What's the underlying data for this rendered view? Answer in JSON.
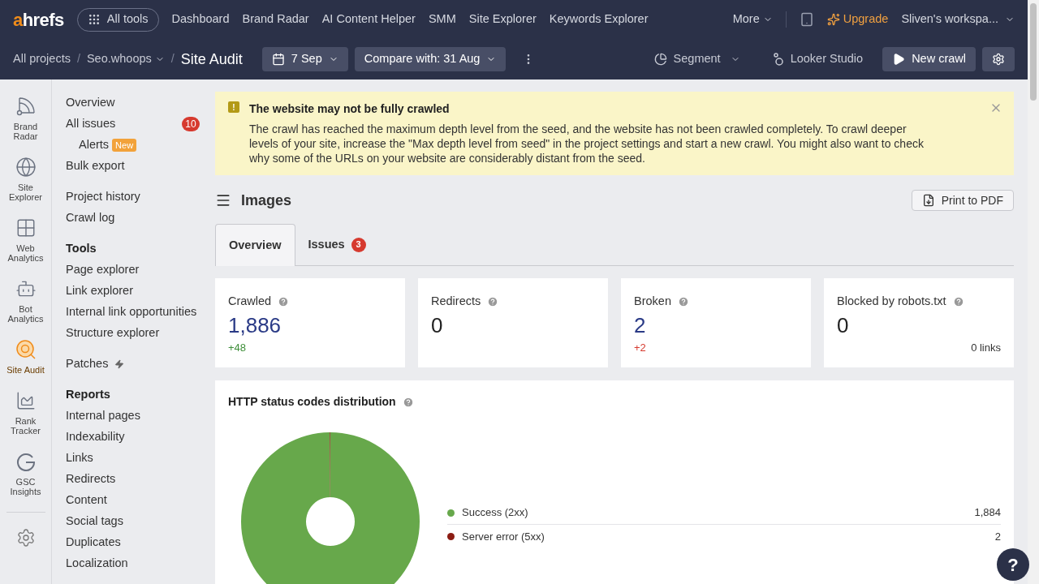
{
  "top_nav": {
    "logo": {
      "accent": "a",
      "rest": "hrefs"
    },
    "all_tools": "All tools",
    "links": [
      "Dashboard",
      "Brand Radar",
      "AI Content Helper",
      "SMM",
      "Site Explorer",
      "Keywords Explorer"
    ],
    "more": "More",
    "upgrade": "Upgrade",
    "workspace": "Sliven's workspa..."
  },
  "toolbar": {
    "breadcrumbs": [
      {
        "label": "All projects",
        "dropdown": false,
        "separator": "/"
      },
      {
        "label": "Seo.whoops",
        "dropdown": true,
        "separator": "/"
      }
    ],
    "current": "Site Audit",
    "date": "7 Sep",
    "compare": "Compare with: 31 Aug",
    "segment": "Segment",
    "looker": "Looker Studio",
    "new_crawl": "New crawl"
  },
  "rail": [
    {
      "kind": "radar",
      "label": "Brand Radar",
      "selected": false
    },
    {
      "kind": "globe",
      "label": "Site Explorer",
      "selected": false
    },
    {
      "kind": "analytics",
      "label": "Web Analytics",
      "selected": false
    },
    {
      "kind": "bot",
      "label": "Bot Analytics",
      "selected": false
    },
    {
      "kind": "audit",
      "label": "Site Audit",
      "selected": true
    },
    {
      "kind": "rank",
      "label": "Rank Tracker",
      "selected": false
    },
    {
      "kind": "gsc",
      "label": "GSC Insights",
      "selected": false
    }
  ],
  "nav": [
    {
      "items": [
        {
          "label": "Overview"
        },
        {
          "label": "All issues",
          "badge": "10",
          "children": [
            {
              "label": "Alerts",
              "tag": "New"
            }
          ]
        },
        {
          "label": "Bulk export"
        }
      ]
    },
    {
      "items": [
        {
          "label": "Project history"
        },
        {
          "label": "Crawl log"
        }
      ]
    },
    {
      "heading": "Tools",
      "items": [
        {
          "label": "Page explorer"
        },
        {
          "label": "Link explorer"
        },
        {
          "label": "Internal link opportunities"
        },
        {
          "label": "Structure explorer"
        }
      ]
    },
    {
      "items": [
        {
          "label": "Patches",
          "kind": "premium"
        }
      ]
    },
    {
      "heading": "Reports",
      "items": [
        {
          "label": "Internal pages"
        },
        {
          "label": "Indexability"
        },
        {
          "label": "Links"
        },
        {
          "label": "Redirects"
        },
        {
          "label": "Content"
        },
        {
          "label": "Social tags"
        },
        {
          "label": "Duplicates"
        },
        {
          "label": "Localization"
        }
      ]
    }
  ],
  "alert": {
    "icon": "!",
    "title": "The website may not be fully crawled",
    "body": "The crawl has reached the maximum depth level from the seed, and the website has not been crawled completely. To crawl deeper levels of your site, increase the \"Max depth level from seed\" in the project settings and start a new crawl. You might also want to check why some of the URLs on your website are considerably distant from the seed."
  },
  "section": {
    "title": "Images",
    "print": "Print to PDF"
  },
  "tabs": [
    {
      "label": "Overview",
      "selected": true
    },
    {
      "label": "Issues",
      "badge": "3",
      "selected": false
    }
  ],
  "stats": [
    {
      "label": "Crawled",
      "value": "1,886",
      "linked": true,
      "change": "+48",
      "positive": true
    },
    {
      "label": "Redirects",
      "value": "0",
      "linked": false
    },
    {
      "label": "Broken",
      "value": "2",
      "linked": true,
      "change": "+2",
      "positive": false
    },
    {
      "label": "Blocked by robots.txt",
      "value": "0",
      "linked": false,
      "note": "0 links"
    }
  ],
  "chart_panel": {
    "title": "HTTP status codes distribution",
    "legend": [
      {
        "value": "1,884",
        "color": "#67a84b"
      },
      {
        "value": "2",
        "color": "#8b1c12"
      }
    ],
    "chart_data": {
      "type": "donut",
      "categories": [
        "Success (2xx)",
        "Server error (5xx)"
      ],
      "values": [
        99.89,
        0.11
      ]
    }
  },
  "help": "?"
}
